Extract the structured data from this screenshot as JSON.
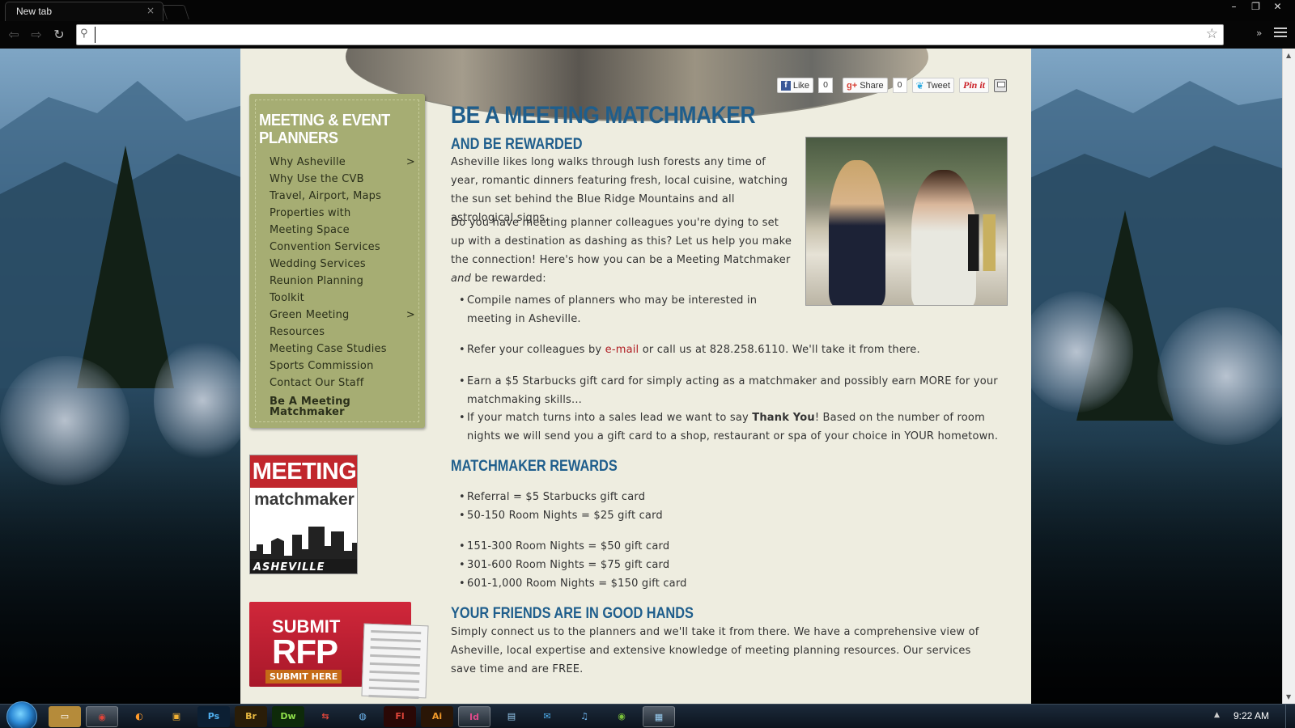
{
  "browser": {
    "tab_title": "New tab",
    "tab_close": "×",
    "address_value": "",
    "window_controls": [
      "–",
      "❐",
      "✕"
    ]
  },
  "share": {
    "like_label": "Like",
    "like_count": "0",
    "share_label": "Share",
    "share_count": "0",
    "tweet_label": "Tweet",
    "pinit_label": "Pin it"
  },
  "sidebar": {
    "title": "MEETING & EVENT PLANNERS",
    "items": [
      {
        "label": "Why Asheville",
        "arrow": ">"
      },
      {
        "label": "Why Use the CVB",
        "arrow": ""
      },
      {
        "label": "Travel, Airport, Maps",
        "arrow": ""
      },
      {
        "label": "Properties with",
        "arrow": ""
      },
      {
        "label": "Meeting Space",
        "arrow": ""
      },
      {
        "label": "Convention Services",
        "arrow": ""
      },
      {
        "label": "Wedding Services",
        "arrow": ""
      },
      {
        "label": "Reunion Planning",
        "arrow": ""
      },
      {
        "label": "Toolkit",
        "arrow": ""
      },
      {
        "label": "Green Meeting",
        "arrow": ">"
      },
      {
        "label": "Resources",
        "arrow": ""
      },
      {
        "label": "Meeting Case Studies",
        "arrow": ""
      },
      {
        "label": "Sports Commission",
        "arrow": ""
      },
      {
        "label": "Contact Our Staff",
        "arrow": ""
      }
    ],
    "active_item": "Be A Meeting Matchmaker"
  },
  "promos": {
    "logo_top": "MEETING",
    "logo_sub": "matchmaker",
    "logo_city": "ASHEVILLE",
    "rfp_line1": "SUBMIT",
    "rfp_line2": "RFP",
    "rfp_button": "SUBMIT HERE"
  },
  "main": {
    "title": "BE A MEETING MATCHMAKER",
    "subhead1": "AND BE REWARDED",
    "para1": "Asheville likes long walks through lush forests any time of year, romantic dinners featuring fresh, local cuisine, watching the sun set behind the Blue Ridge Mountains and all astrological signs.",
    "para2_start": "Do you have meeting planner colleagues you're dying to set up with a destination as dashing as this? Let us help you make the connection! Here's how you can be a Meeting Matchmaker ",
    "para2_em": "and",
    "para2_end": " be rewarded:",
    "bullet1": "Compile names of planners who may be interested in meeting in Asheville.",
    "bullet2_start": "Refer your colleagues by ",
    "bullet2_link": "e-mail",
    "bullet2_end": " or call us at 828.258.6110. We'll take it from there.",
    "bullet3": "Earn a $5 Starbucks gift card for simply acting as a matchmaker and possibly earn MORE for your matchmaking skills...",
    "bullet4_start": "If your match turns into a sales lead we want to say ",
    "bullet4_bold": "Thank You",
    "bullet4_end": "! Based on the number of room nights we will send you a gift card to a shop, restaurant or spa of your choice in YOUR hometown.",
    "subhead2": "MATCHMAKER REWARDS",
    "rewards": [
      "Referral = $5 Starbucks gift card",
      "50-150 Room Nights = $25 gift card",
      "151-300 Room Nights = $50 gift card",
      "301-600 Room Nights = $75 gift card",
      "601-1,000 Room Nights = $150 gift card"
    ],
    "subhead3": "YOUR FRIENDS ARE IN GOOD HANDS",
    "para3": "Simply connect us to the planners and we'll take it from there. We have a comprehensive view of Asheville, local expertise and extensive knowledge of meeting planning resources. Our services save time and are FREE."
  },
  "taskbar": {
    "clock": "9:22 AM",
    "apps": [
      "Ps",
      "Br",
      "Dw",
      "Fl",
      "Ai",
      "Id"
    ]
  }
}
